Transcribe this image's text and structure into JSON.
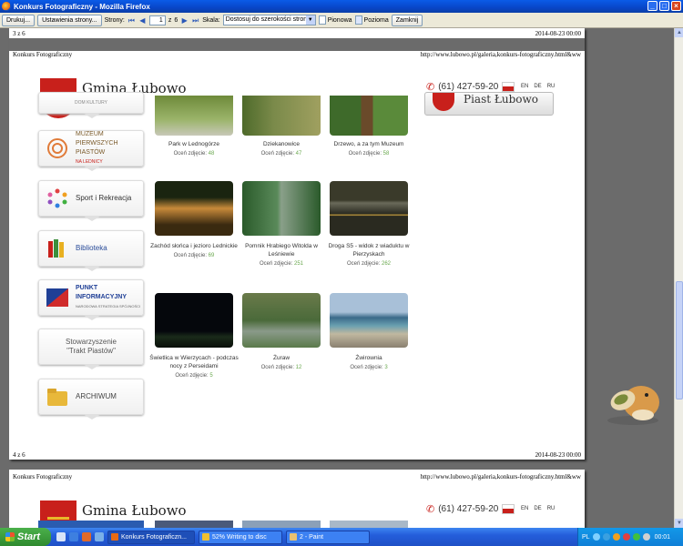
{
  "window": {
    "title": "Konkurs Fotograficzny - Mozilla Firefox"
  },
  "toolbar": {
    "print": "Drukuj...",
    "page_setup": "Ustawienia strony...",
    "pages_label": "Strony:",
    "page_current": "1",
    "page_of": "z",
    "page_total": "6",
    "scale_label": "Skala:",
    "scale_value": "Dostosuj do szerokości strony",
    "portrait": "Pionowa",
    "landscape": "Pozioma",
    "close": "Zamknij"
  },
  "page1": {
    "top_left": "3 z 6",
    "top_right": "2014-08-23 00:00",
    "header_left": "Konkurs Fotograficzny",
    "header_right": "http://www.lubowo.pl/galeria,konkurs-fotograficzny.html&ww",
    "bottom_left": "4 z 6",
    "bottom_right": "2014-08-23 00:00"
  },
  "site": {
    "brand": "Gmina Łubowo",
    "phone": "(61) 427-59-20",
    "langs": [
      "EN",
      "DE",
      "RU"
    ],
    "banner": "Piast Łubowo",
    "sidebar_top_partial": "DOM KULTURY",
    "sidebar": [
      {
        "label": "MUZEUM PIERWSZYCH PIASTÓW",
        "sub": "NA LEDNICY"
      },
      {
        "label": "Sport i Rekreacja"
      },
      {
        "label": "Biblioteka"
      },
      {
        "label": "PUNKT INFORMACYJNY",
        "sub": "NARODOWA STRATEGIA SPÓJNOŚCI"
      },
      {
        "label": "Stowarzyszenie \"Trakt Piastów\""
      },
      {
        "label": "ARCHIWUM"
      }
    ]
  },
  "gallery": {
    "rate_label": "Oceń zdjęcie:",
    "rows": [
      [
        {
          "caption": "Park w Lednogórze",
          "votes": "48"
        },
        {
          "caption": "Dziekanowice",
          "votes": "47"
        },
        {
          "caption": "Drzewo, a za tym Muzeum",
          "votes": "58"
        }
      ],
      [
        {
          "caption": "Zachód słońca i jezioro Lednickie",
          "votes": "69"
        },
        {
          "caption": "Pomnik Hrabiego Witolda w Leśniewie",
          "votes": "251"
        },
        {
          "caption": "Droga S5 - widok z wiaduktu w Pierzyskach",
          "votes": "262"
        }
      ],
      [
        {
          "caption": "Świetlica w Wierzycach - podczas nocy z Perseidami",
          "votes": "5"
        },
        {
          "caption": "Żuraw",
          "votes": "12"
        },
        {
          "caption": "Żwirownia",
          "votes": "3"
        }
      ]
    ]
  },
  "page2": {
    "header_left": "Konkurs Fotograficzny",
    "header_right": "http://www.lubowo.pl/galeria,konkurs-fotograficzny.html&ww",
    "brand": "Gmina Łubowo",
    "phone": "(61) 427-59-20",
    "langs": [
      "EN",
      "DE",
      "RU"
    ]
  },
  "taskbar": {
    "start": "Start",
    "tasks": [
      {
        "label": "Konkurs Fotograficzn..."
      },
      {
        "label": "52% Writing to disc"
      },
      {
        "label": "2 - Paint"
      }
    ],
    "lang": "PL",
    "clock": "00:01"
  },
  "colors": {
    "accent_red": "#c8201b",
    "xp_blue": "#245edb",
    "rating_green": "#6aa84f"
  }
}
